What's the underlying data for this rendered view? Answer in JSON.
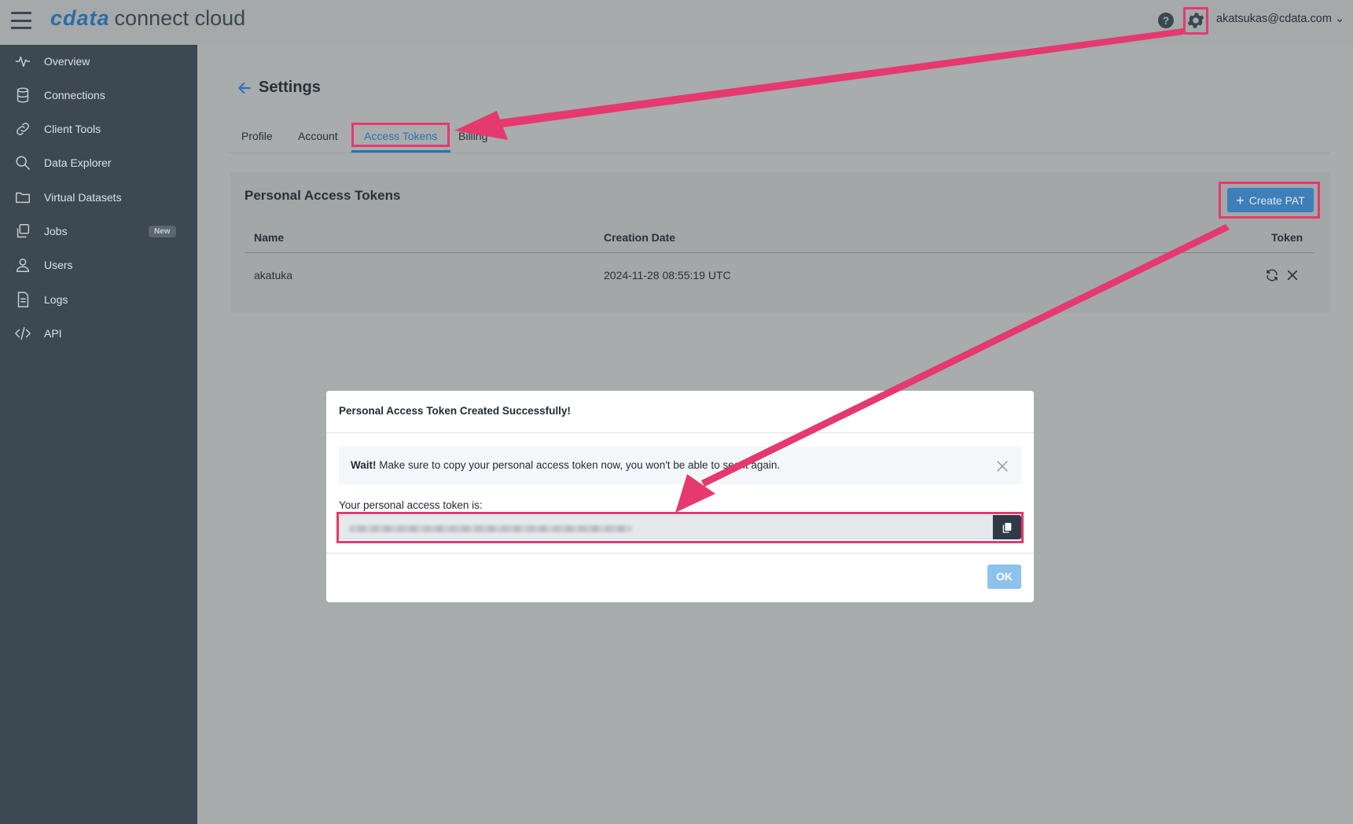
{
  "app": {
    "logo_brand": "cdata",
    "logo_product": "connect cloud",
    "user_email": "akatsukas@cdata.com",
    "help_glyph": "?"
  },
  "sidebar": {
    "items": [
      {
        "label": "Overview",
        "icon": "activity-icon"
      },
      {
        "label": "Connections",
        "icon": "database-icon"
      },
      {
        "label": "Client Tools",
        "icon": "link-icon"
      },
      {
        "label": "Data Explorer",
        "icon": "search-icon"
      },
      {
        "label": "Virtual Datasets",
        "icon": "folder-icon"
      },
      {
        "label": "Jobs",
        "icon": "copy-icon",
        "badge": "New"
      },
      {
        "label": "Users",
        "icon": "user-icon"
      },
      {
        "label": "Logs",
        "icon": "document-icon"
      },
      {
        "label": "API",
        "icon": "code-icon"
      }
    ]
  },
  "page": {
    "title": "Settings",
    "tabs": [
      "Profile",
      "Account",
      "Access Tokens",
      "Billing"
    ],
    "active_tab": "Access Tokens"
  },
  "pat": {
    "section_title": "Personal Access Tokens",
    "create_label": "Create PAT",
    "columns": [
      "Name",
      "Creation Date",
      "Token"
    ],
    "rows": [
      {
        "name": "akatuka",
        "creation_date": "2024-11-28 08:55:19 UTC"
      }
    ]
  },
  "modal": {
    "title": "Personal Access Token Created Successfully!",
    "alert_strong": "Wait!",
    "alert_text": " Make sure to copy your personal access token now, you won't be able to see it again.",
    "token_label": "Your personal access token is:",
    "ok_label": "OK"
  },
  "colors": {
    "accent": "#2d72b3",
    "annotation": "#e5396f",
    "sidebar_bg": "#3c4852",
    "ok_button": "#8dc2ef"
  }
}
